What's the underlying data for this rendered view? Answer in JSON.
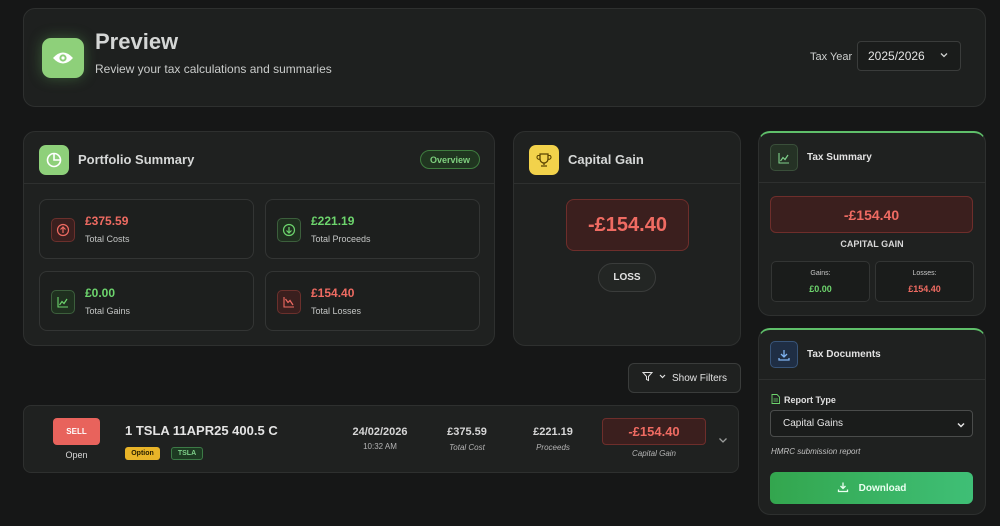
{
  "header": {
    "title": "Preview",
    "subtitle": "Review your tax calculations and summaries",
    "tax_year_label": "Tax Year",
    "tax_year_value": "2025/2026",
    "icon": "eye-icon"
  },
  "portfolio": {
    "title": "Portfolio Summary",
    "badge": "Overview",
    "icon": "pie-chart-icon",
    "stats": [
      {
        "value": "£375.59",
        "label": "Total Costs",
        "icon": "arrow-up-circle-icon",
        "tone": "red"
      },
      {
        "value": "£221.19",
        "label": "Total Proceeds",
        "icon": "arrow-down-circle-icon",
        "tone": "green"
      },
      {
        "value": "£0.00",
        "label": "Total Gains",
        "icon": "trend-up-icon",
        "tone": "green"
      },
      {
        "value": "£154.40",
        "label": "Total Losses",
        "icon": "trend-down-icon",
        "tone": "red"
      }
    ]
  },
  "capital_gain": {
    "title": "Capital Gain",
    "icon": "trophy-icon",
    "value": "-£154.40",
    "status": "LOSS"
  },
  "tax_summary": {
    "title": "Tax Summary",
    "icon": "chart-line-icon",
    "value": "-£154.40",
    "caption": "CAPITAL GAIN",
    "gains_label": "Gains:",
    "gains_value": "£0.00",
    "losses_label": "Losses:",
    "losses_value": "£154.40"
  },
  "tax_documents": {
    "title": "Tax Documents",
    "icon": "download-icon",
    "report_type_label": "Report Type",
    "report_type_value": "Capital Gains",
    "note": "HMRC submission report",
    "download_label": "Download"
  },
  "filters": {
    "label": "Show Filters",
    "icon": "filter-icon"
  },
  "trade": {
    "side": "SELL",
    "status": "Open",
    "name": "1 TSLA 11APR25 400.5 C",
    "tag_type": "Option",
    "tag_ticker": "TSLA",
    "date": "24/02/2026",
    "time": "10:32 AM",
    "total_cost": "£375.59",
    "total_cost_label": "Total Cost",
    "proceeds": "£221.19",
    "proceeds_label": "Proceeds",
    "capital_gain": "-£154.40",
    "capital_gain_label": "Capital Gain"
  },
  "colors": {
    "background": "#161717",
    "card": "#1f2120",
    "accent_green": "#5fbf6a",
    "loss_red": "#ef6b62",
    "gain_green": "#6dd56d"
  }
}
